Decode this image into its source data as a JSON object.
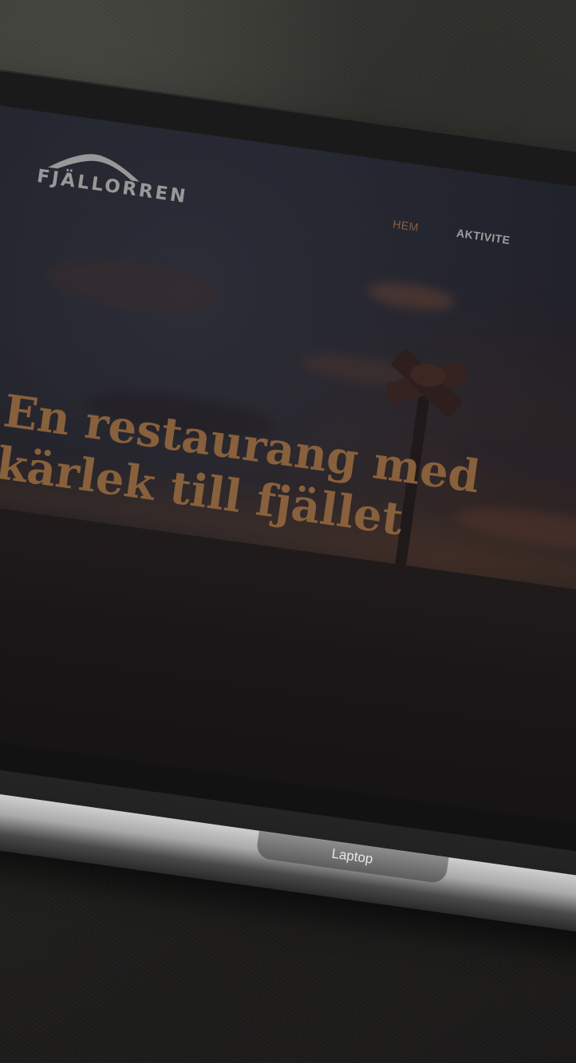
{
  "brand": {
    "name": "Fjällorren",
    "logo_text": "FJÄLLORREN"
  },
  "nav": {
    "items": [
      {
        "label": "HEM",
        "active": true
      },
      {
        "label": "AKTIVITE",
        "active": false
      }
    ]
  },
  "hero": {
    "headline_line1": "En restaurang med",
    "headline_line2": "kärlek till fjället"
  },
  "device": {
    "label": "Laptop"
  },
  "colors": {
    "accent": "#c98c55",
    "nav_text": "#e8e8e8",
    "background": "#262624"
  },
  "icons": [
    "mountain-logo-icon",
    "signpost-icon"
  ]
}
